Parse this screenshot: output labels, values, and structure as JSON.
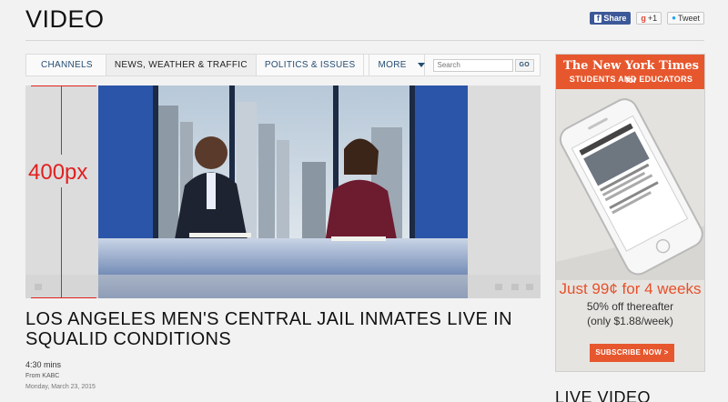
{
  "header": {
    "title": "VIDEO"
  },
  "share": {
    "facebook_label": "Share",
    "gplus_label": "+1",
    "twitter_label": "Tweet"
  },
  "nav": {
    "tabs": [
      {
        "label": "CHANNELS"
      },
      {
        "label": "NEWS, WEATHER & TRAFFIC"
      },
      {
        "label": "POLITICS & ISSUES"
      }
    ],
    "more_label": "MORE",
    "search_placeholder": "Search",
    "go_label": "GO"
  },
  "dimension_annotation": {
    "label": "400px",
    "color": "#e22020"
  },
  "video": {
    "headline": "LOS ANGELES MEN'S CENTRAL JAIL INMATES LIVE IN SQUALID CONDITIONS",
    "duration": "4:30 mins",
    "source": "From KABC",
    "date": "Monday, March 23, 2015"
  },
  "ad": {
    "brand": "The New York Times",
    "brand_suffix": "for",
    "subtitle": "STUDENTS AND EDUCATORS",
    "offer": "Just 99¢ for 4 weeks",
    "line2": "50% off thereafter",
    "line3": "(only $1.88/week)",
    "cta": "SUBSCRIBE NOW >",
    "accent": "#e7572e"
  },
  "sidebar": {
    "live_video_title": "LIVE VIDEO"
  },
  "colors": {
    "nav_link": "#264d73",
    "background": "#f2f2f2"
  }
}
